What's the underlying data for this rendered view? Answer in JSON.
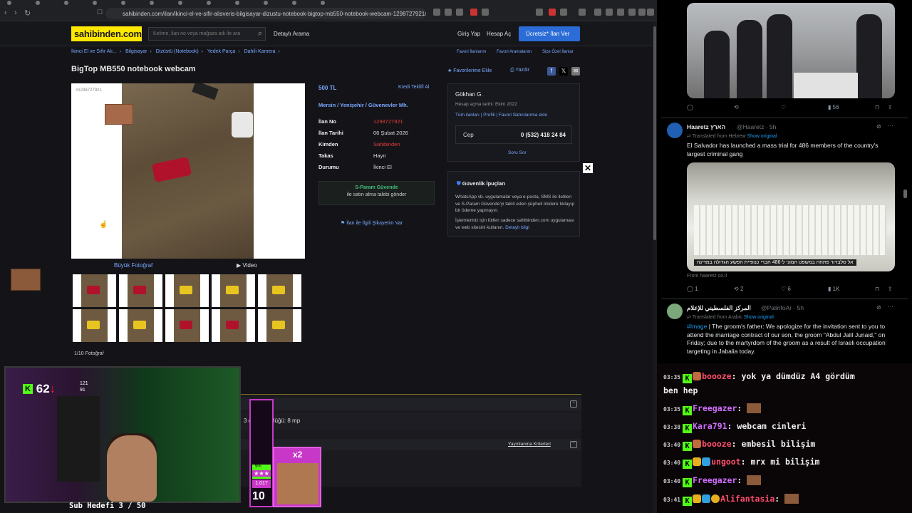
{
  "browser": {
    "url": "sahibinden.com/ilan/ikinci-el-ve-sifir-alisveris-bilgisayar-dizustu-notebook-bigtop-mb550-notebook-webcam-1298727921/detay"
  },
  "site": {
    "logo": "sahibinden.com",
    "search_placeholder": "Kelime, ilan no veya mağaza adı ile ara",
    "detailed_search": "Detaylı Arama",
    "login": "Giriş Yap",
    "register": "Hesap Aç",
    "post_ad": "Ücretsiz* İlan Ver"
  },
  "breadcrumb": [
    "İkinci El ve Sıfır Alı...",
    "Bilgisayar",
    "Dizüstü (Notebook)",
    "Yedek Parça",
    "Dahili Kamera"
  ],
  "top_links": [
    "Favori İlanlarım",
    "Favori Aramalarım",
    "Size Özel İlanlar"
  ],
  "listing": {
    "title": "BigTop MB550 notebook webcam",
    "photo_number": "#1298727921",
    "large_photo": "Büyük Fotoğraf",
    "video": "Video",
    "photo_count": "1/10 Fotoğraf",
    "price": "500 TL",
    "credit": "Kredi Teklifi Al",
    "location": "Mersin / Yenişehir / Güvenevler Mh.",
    "fields": [
      {
        "label": "İlan No",
        "value": "1298727921",
        "red": true
      },
      {
        "label": "İlan Tarihi",
        "value": "06 Şubat 2026",
        "red": false
      },
      {
        "label": "Kimden",
        "value": "Sahibinden",
        "red": true
      },
      {
        "label": "Takas",
        "value": "Hayır",
        "red": false
      },
      {
        "label": "Durumu",
        "value": "İkinci El",
        "red": false
      }
    ],
    "spara_title": "S-Param Güvende",
    "spara_sub": "ile satın alma talebi gönder",
    "complaint": "İlan ile İlgili Şikayetim Var",
    "favorite": "Favorilerime Ekle",
    "print": "Yazdır"
  },
  "seller": {
    "name": "Gökhan G.",
    "since": "Hesap açma tarihi: Ekim 2022",
    "links": [
      "Tüm ilanları",
      "Profili",
      "Favori Satıcılarıma ekle"
    ],
    "phone_label": "Cep",
    "phone": "0 (532) 418 24 84",
    "ask": "Soru Sor"
  },
  "security": {
    "title": "Güvenlik İpuçları",
    "p1": "WhatsApp vb. uygulamalar veya e-posta, SMS ile iletilen ve S-Param Güvende'yi taklit eden şüpheli linklere tıklayıp bir ödeme yapmayın.",
    "p2": "İşlemleriniz için lütfen sadece sahibinden.com uygulaması ve web sitesini kullanın.",
    "more": "Detaylı bilgi"
  },
  "lower": {
    "resolution": "Kamera çözünürlüğü: 8 mp",
    "resolution_visible": "3       o çözünürlüğü: 8 mp",
    "criteria": "Yayınlanma Kriterleri"
  },
  "tweets": {
    "t1_actions": {
      "views": "56"
    },
    "t2": {
      "name": "Haaretz הארץ",
      "handle": "@Haaretz · 5h",
      "translated": "Translated from Hebrew",
      "show_original": "Show original",
      "text": "El Salvador has launched a mass trial for 486 members of the country's largest criminal gang",
      "caption": "אל סלבדור פתחה במשפט המוני ל-486 חברי כנופיית הפשע הגדולה במדינה",
      "source": "From haaretz.co.il",
      "replies": "1",
      "retweets": "2",
      "likes": "6",
      "views": "1K"
    },
    "t3": {
      "name": "المركز الفلسطيني للإعلام",
      "handle": "@PalinfoAr · 5h",
      "translated": "Translated from Arabic",
      "show_original": "Show original",
      "tag": "#Image",
      "text": " | The groom's father: We apologize for the invitation sent to you to attend the marriage contract of our son, the groom \"Abdul Jalil Junaid,\" on Friday; due to the martyrdom of the groom as a result of Israeli occupation targeting in Jabalia today."
    }
  },
  "chat": [
    {
      "time": "03:35",
      "user": "boooze",
      "msg": "yok ya dümdüz A4 gördüm",
      "cont": "ben hep",
      "color": "u2"
    },
    {
      "time": "03:35",
      "user": "Freegazer",
      "msg": "",
      "emote": true,
      "color": "u3"
    },
    {
      "time": "03:38",
      "user": "Kara791",
      "msg": "webcam cinleri",
      "color": "u3"
    },
    {
      "time": "03:40",
      "user": "boooze",
      "msg": "embesil bilişim",
      "color": "u2"
    },
    {
      "time": "03:40",
      "user": "ungoot",
      "msg": "mrx mi bilişim",
      "color": "u2"
    },
    {
      "time": "03:40",
      "user": "Freegazer",
      "msg": "",
      "emote": true,
      "color": "u3"
    },
    {
      "time": "03:41",
      "user": "Alifantasia",
      "msg": "",
      "emote": true,
      "color": "u2"
    }
  ],
  "stream": {
    "viewers": "62",
    "stat_a": "121",
    "stat_b": "91",
    "sub_goal": "Sub Hedefi 3 / 50",
    "goal_pct": "9%",
    "goal_count": "1,017",
    "goal_level": "10",
    "multiplier": "x2"
  }
}
